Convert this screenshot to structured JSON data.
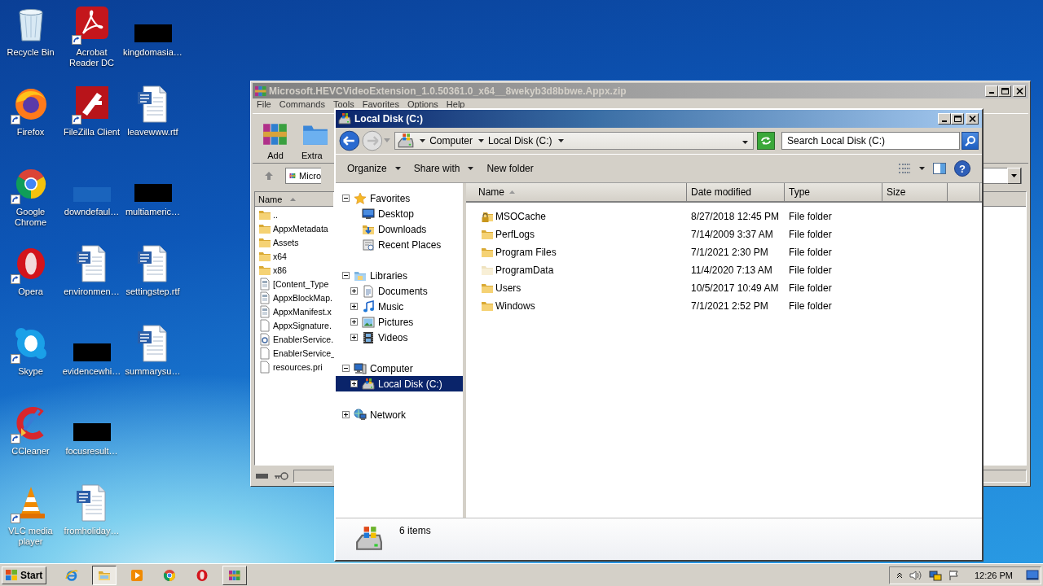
{
  "desktop": {
    "icon_columns": [
      [
        {
          "label": "Recycle Bin",
          "kind": "recycle-bin",
          "shortcut": false
        },
        {
          "label": "Firefox",
          "kind": "firefox",
          "shortcut": true
        },
        {
          "label": "Google Chrome",
          "kind": "chrome",
          "shortcut": true
        },
        {
          "label": "Opera",
          "kind": "opera",
          "shortcut": true
        },
        {
          "label": "Skype",
          "kind": "skype",
          "shortcut": true
        },
        {
          "label": "CCleaner",
          "kind": "ccleaner",
          "shortcut": true
        },
        {
          "label": "VLC media player",
          "kind": "vlc",
          "shortcut": true
        }
      ],
      [
        {
          "label": "Acrobat Reader DC",
          "kind": "acrobat",
          "shortcut": true
        },
        {
          "label": "FileZilla Client",
          "kind": "filezilla",
          "shortcut": true
        },
        {
          "label": "downdefaul…",
          "kind": "blank",
          "shortcut": false
        },
        {
          "label": "environmen…",
          "kind": "word",
          "shortcut": false
        },
        {
          "label": "evidencewhi…",
          "kind": "redacted",
          "shortcut": false
        },
        {
          "label": "focusresult…",
          "kind": "redacted",
          "shortcut": false
        },
        {
          "label": "fromholiday…",
          "kind": "word",
          "shortcut": false
        }
      ],
      [
        {
          "label": "kingdomasia…",
          "kind": "redacted",
          "shortcut": false
        },
        {
          "label": "leavewww.rtf",
          "kind": "word",
          "shortcut": false
        },
        {
          "label": "multiameric…",
          "kind": "redacted",
          "shortcut": false
        },
        {
          "label": "settingstep.rtf",
          "kind": "word",
          "shortcut": false
        },
        {
          "label": "summarysu…",
          "kind": "word",
          "shortcut": false
        }
      ]
    ]
  },
  "archive_window": {
    "title": "Microsoft.HEVCVideoExtension_1.0.50361.0_x64__8wekyb3d8bbwe.Appx.zip",
    "active": false,
    "menu": [
      "File",
      "Commands",
      "Tools",
      "Favorites",
      "Options",
      "Help"
    ],
    "toolbar": [
      {
        "label": "Add",
        "kind": "add"
      },
      {
        "label": "Extra",
        "kind": "extract"
      }
    ],
    "address": "Micro",
    "column": "Name",
    "files": [
      {
        "name": "..",
        "kind": "folder"
      },
      {
        "name": "AppxMetadata",
        "kind": "folder"
      },
      {
        "name": "Assets",
        "kind": "folder"
      },
      {
        "name": "x64",
        "kind": "folder"
      },
      {
        "name": "x86",
        "kind": "folder"
      },
      {
        "name": "[Content_Type",
        "kind": "xml"
      },
      {
        "name": "AppxBlockMap.",
        "kind": "xml"
      },
      {
        "name": "AppxManifest.x",
        "kind": "xml"
      },
      {
        "name": "AppxSignature.",
        "kind": "file"
      },
      {
        "name": "EnablerService.",
        "kind": "dll"
      },
      {
        "name": "EnablerService_",
        "kind": "file"
      },
      {
        "name": "resources.pri",
        "kind": "file"
      }
    ]
  },
  "explorer_window": {
    "title": "Local Disk (C:)",
    "active": true,
    "breadcrumb": [
      "Computer",
      "Local Disk (C:)"
    ],
    "search": {
      "placeholder": "Search Local Disk (C:)"
    },
    "commands": [
      {
        "label": "Organize",
        "kind": "menu"
      },
      {
        "label": "Share with",
        "kind": "menu"
      },
      {
        "label": "New folder",
        "kind": "plain"
      }
    ],
    "help": "?",
    "nav": [
      {
        "label": "Favorites",
        "kind": "star",
        "expanded": true,
        "selected": false,
        "children": [
          {
            "label": "Desktop",
            "kind": "desktop",
            "selected": false
          },
          {
            "label": "Downloads",
            "kind": "downloads",
            "selected": false
          },
          {
            "label": "Recent Places",
            "kind": "recent",
            "selected": false
          }
        ]
      },
      {
        "label": "Libraries",
        "kind": "libraries",
        "expanded": true,
        "selected": false,
        "children": [
          {
            "label": "Documents",
            "kind": "documents",
            "expanded": false,
            "selected": false
          },
          {
            "label": "Music",
            "kind": "music",
            "expanded": false,
            "selected": false
          },
          {
            "label": "Pictures",
            "kind": "pictures",
            "expanded": false,
            "selected": false
          },
          {
            "label": "Videos",
            "kind": "videos",
            "expanded": false,
            "selected": false
          }
        ]
      },
      {
        "label": "Computer",
        "kind": "computer",
        "expanded": true,
        "selected": false,
        "children": [
          {
            "label": "Local Disk (C:)",
            "kind": "drive",
            "expanded": false,
            "selected": true
          }
        ]
      },
      {
        "label": "Network",
        "kind": "network",
        "expanded": false,
        "selected": false
      }
    ],
    "columns": [
      {
        "label": "Name",
        "sorted": true
      },
      {
        "label": "Date modified",
        "sorted": false
      },
      {
        "label": "Type",
        "sorted": false
      },
      {
        "label": "Size",
        "sorted": false
      }
    ],
    "files": [
      {
        "name": "MSOCache",
        "kind": "locked-folder",
        "date": "8/27/2018 12:45 PM",
        "type": "File folder"
      },
      {
        "name": "PerfLogs",
        "kind": "folder",
        "date": "7/14/2009 3:37 AM",
        "type": "File folder"
      },
      {
        "name": "Program Files",
        "kind": "folder",
        "date": "7/1/2021 2:30 PM",
        "type": "File folder"
      },
      {
        "name": "ProgramData",
        "kind": "hidden-folder",
        "date": "11/4/2020 7:13 AM",
        "type": "File folder"
      },
      {
        "name": "Users",
        "kind": "folder",
        "date": "10/5/2017 10:49 AM",
        "type": "File folder"
      },
      {
        "name": "Windows",
        "kind": "folder",
        "date": "7/1/2021 2:52 PM",
        "type": "File folder"
      }
    ],
    "status": "6 items"
  },
  "taskbar": {
    "start": "Start",
    "buttons": [
      {
        "kind": "ie",
        "open": false,
        "selected": false
      },
      {
        "kind": "explorer",
        "open": true,
        "selected": true
      },
      {
        "kind": "media",
        "open": false,
        "selected": false
      },
      {
        "kind": "chrome",
        "open": false,
        "selected": false
      },
      {
        "kind": "opera",
        "open": false,
        "selected": false
      },
      {
        "kind": "winrar",
        "open": true,
        "selected": false
      }
    ],
    "clock": "12:26 PM"
  }
}
